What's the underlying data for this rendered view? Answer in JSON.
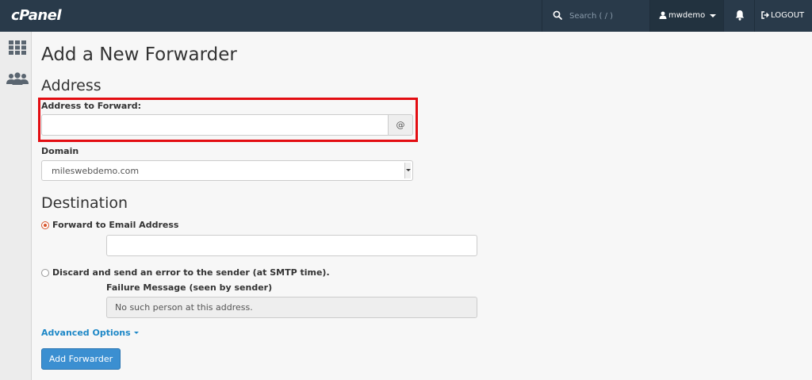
{
  "topbar": {
    "logo": "cPanel",
    "search_placeholder": "Search ( / )",
    "username": "mwdemo",
    "logout_label": "LOGOUT"
  },
  "page": {
    "title": "Add a New Forwarder"
  },
  "address": {
    "section_title": "Address",
    "forward_label": "Address to Forward:",
    "forward_value": "",
    "at_symbol": "@",
    "domain_label": "Domain",
    "domain_value": "mileswebdemo.com"
  },
  "destination": {
    "section_title": "Destination",
    "forward_email_label": "Forward to Email Address",
    "forward_email_value": "",
    "forward_email_selected": true,
    "discard_label": "Discard and send an error to the sender (at SMTP time).",
    "failure_label": "Failure Message (seen by sender)",
    "failure_value": "No such person at this address."
  },
  "advanced_label": "Advanced Options",
  "submit_label": "Add Forwarder",
  "colors": {
    "topbar": "#293a4a",
    "highlight": "#e30d12",
    "primary": "#3b8fd1",
    "link": "#1e88c7"
  }
}
